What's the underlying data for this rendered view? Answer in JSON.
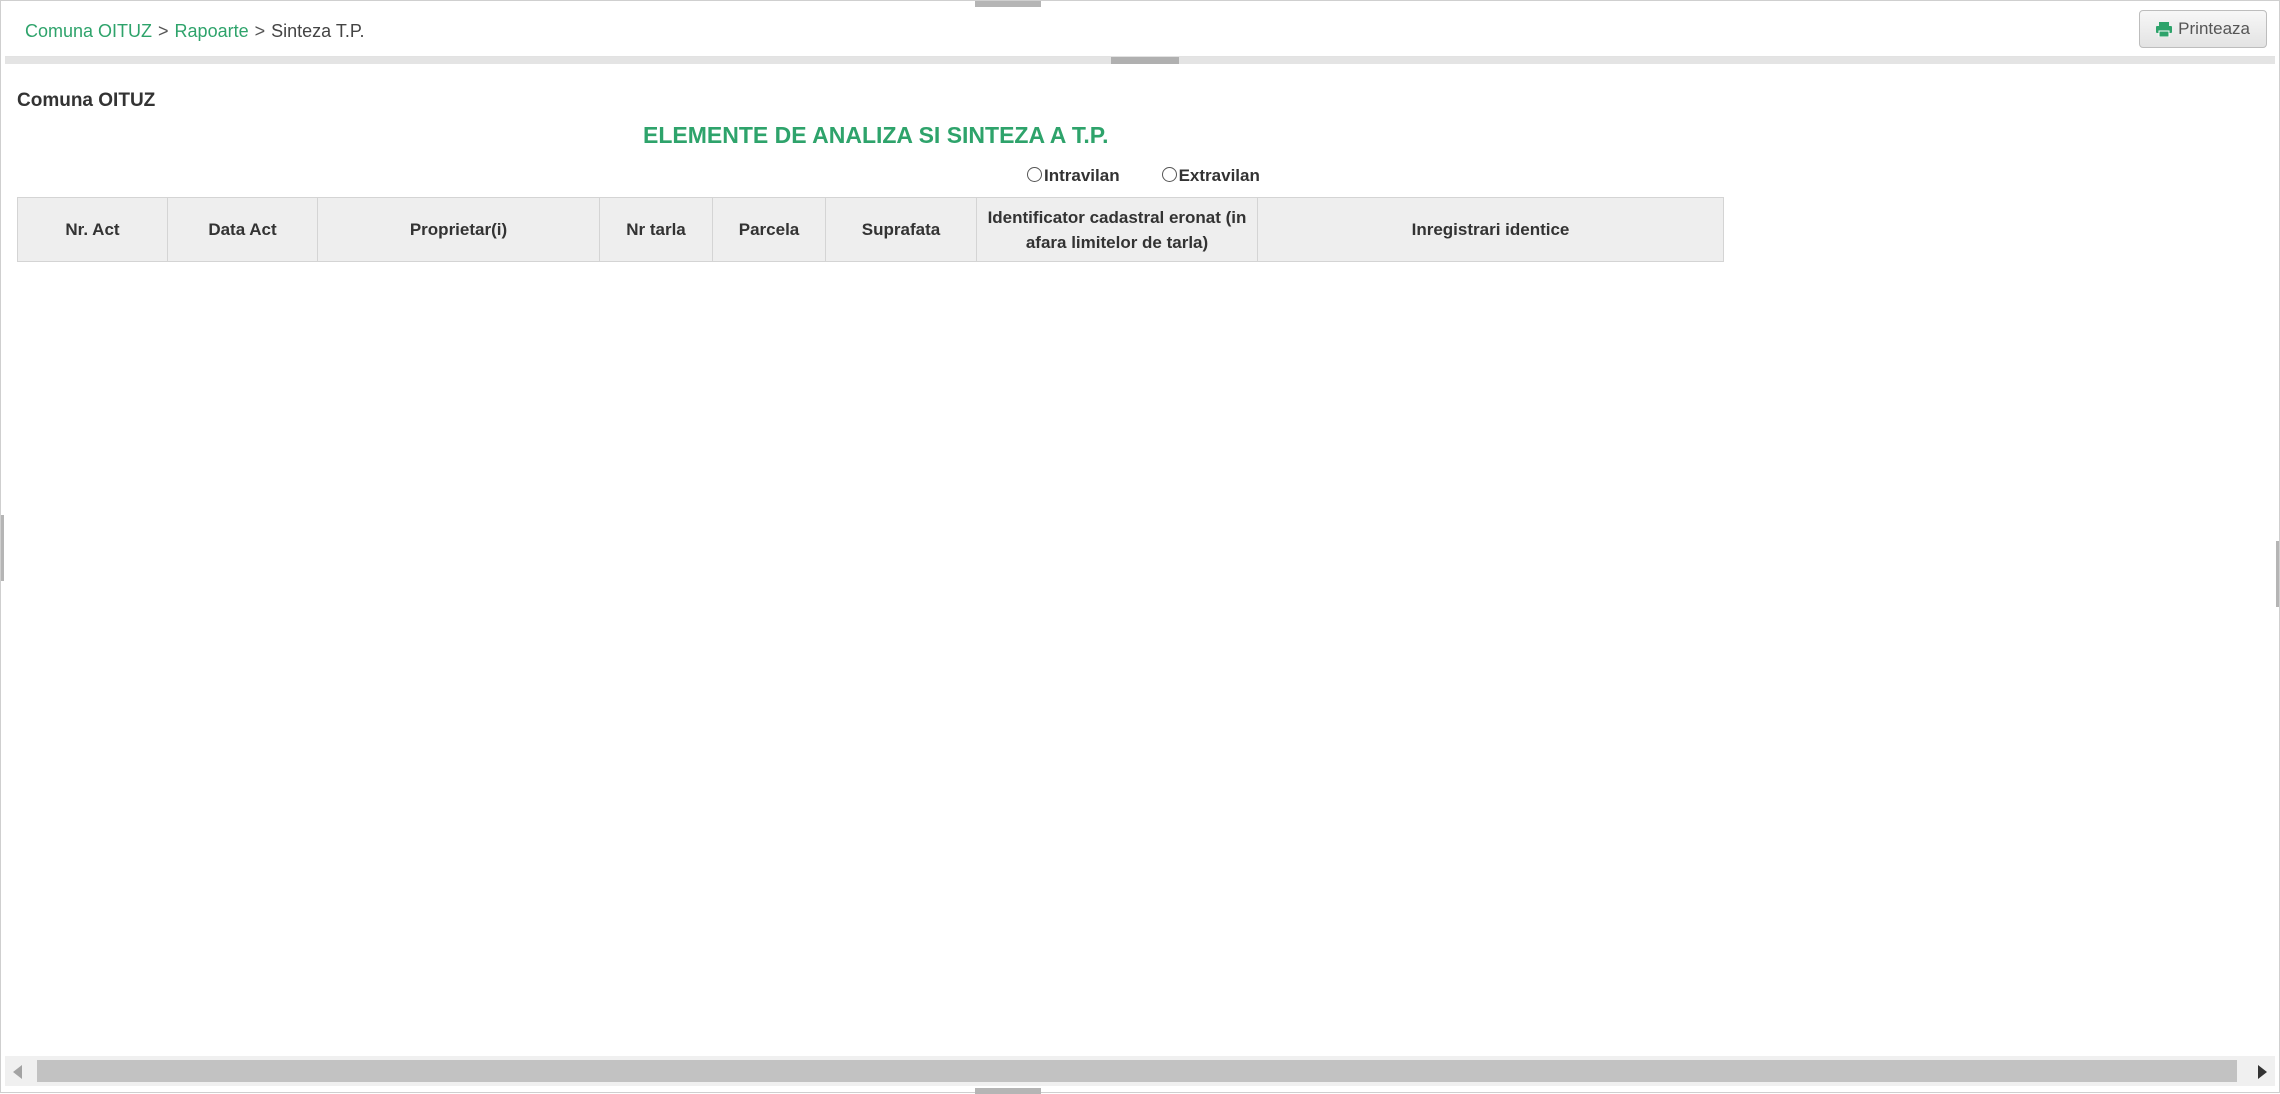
{
  "breadcrumb": {
    "items": [
      "Comuna OITUZ",
      "Rapoarte",
      "Sinteza T.P."
    ],
    "separator": ">"
  },
  "toolbar": {
    "print_label": "Printeaza",
    "print_icon": "printer-icon"
  },
  "report": {
    "org_name": "Comuna OITUZ",
    "title": "ELEMENTE DE ANALIZA SI SINTEZA A T.P."
  },
  "filters": {
    "options": [
      "Intravilan",
      "Extravilan"
    ]
  },
  "table": {
    "columns": [
      "Nr. Act",
      "Data Act",
      "Proprietar(i)",
      "Nr tarla",
      "Parcela",
      "Suprafata",
      "Identificator cadastral eronat (in afara limitelor de tarla)",
      "Inregistrari identice"
    ],
    "rows": []
  },
  "colors": {
    "accent": "#2ea36b",
    "header_bg": "#eeeeee",
    "text": "#333333"
  }
}
